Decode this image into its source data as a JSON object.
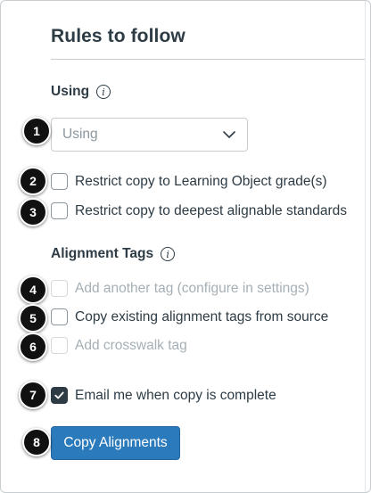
{
  "panel": {
    "title": "Rules to follow"
  },
  "using": {
    "label": "Using",
    "info_icon": "info-icon",
    "select_value": "Using",
    "select_icon": "chevron-down-icon"
  },
  "options": {
    "restrict_grade": {
      "label": "Restrict copy to Learning Object grade(s)",
      "checked": false,
      "enabled": true
    },
    "restrict_deepest": {
      "label": "Restrict copy to deepest alignable standards",
      "checked": false,
      "enabled": true
    }
  },
  "alignment_tags": {
    "label": "Alignment Tags",
    "info_icon": "info-icon",
    "add_another": {
      "label": "Add another tag (configure in settings)",
      "checked": false,
      "enabled": false
    },
    "copy_existing": {
      "label": "Copy existing alignment tags from source",
      "checked": false,
      "enabled": true
    },
    "add_crosswalk": {
      "label": "Add crosswalk tag",
      "checked": false,
      "enabled": false
    }
  },
  "email": {
    "label": "Email me when copy is complete",
    "checked": true,
    "enabled": true
  },
  "submit": {
    "label": "Copy Alignments"
  },
  "callouts": [
    "1",
    "2",
    "3",
    "4",
    "5",
    "6",
    "7",
    "8"
  ],
  "colors": {
    "text": "#2d3b45",
    "disabled_text": "#a5afb5",
    "button": "#2b7abc",
    "badge": "#111111"
  }
}
